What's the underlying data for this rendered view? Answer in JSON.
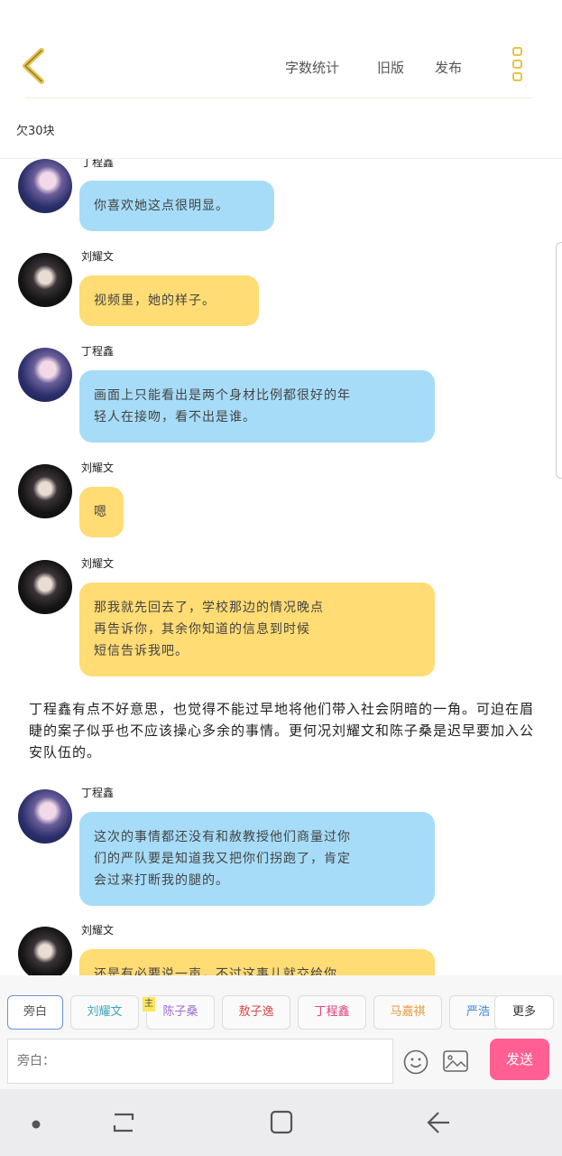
{
  "topbar": {
    "actions": [
      "字数统计",
      "旧版",
      "发布"
    ]
  },
  "coin_text": "欠30块",
  "messages": [
    {
      "type": "chat",
      "speaker": "丁程鑫",
      "side": "blue",
      "text": "你喜欢她这点很明显。"
    },
    {
      "type": "chat",
      "speaker": "刘耀文",
      "side": "yellow",
      "text": "视频里，她的样子。"
    },
    {
      "type": "chat",
      "speaker": "丁程鑫",
      "side": "blue",
      "text": "画面上只能看出是两个身材比例都很好的年\n轻人在接吻，看不出是谁。"
    },
    {
      "type": "chat",
      "speaker": "刘耀文",
      "side": "yellow",
      "text": "嗯"
    },
    {
      "type": "chat",
      "speaker": "刘耀文",
      "side": "yellow",
      "text": "那我就先回去了，学校那边的情况晚点\n再告诉你，其余你知道的信息到时候\n短信告诉我吧。"
    },
    {
      "type": "narration",
      "text": "丁程鑫有点不好意思，也觉得不能过早地将他们带入社会阴暗的一角。可迫在眉睫的案子似乎也不应该操心多余的事情。更何况刘耀文和陈子桑是迟早要加入公安队伍的。"
    },
    {
      "type": "chat",
      "speaker": "丁程鑫",
      "side": "blue",
      "text": "这次的事情都还没有和赦教授他们商量过你\n们的严队要是知道我又把你们拐跑了，肯定\n会过来打断我的腿的。"
    },
    {
      "type": "chat",
      "speaker": "刘耀文",
      "side": "yellow",
      "text": "还是有必要说一声，不过这事儿就交给你"
    }
  ],
  "characters": [
    {
      "label": "旁白",
      "color": "#555555",
      "active": true
    },
    {
      "label": "刘耀文",
      "color": "#3aa7b8"
    },
    {
      "label": "陈子桑",
      "color": "#9a6fd0"
    },
    {
      "label": "敖子逸",
      "color": "#d94a4a"
    },
    {
      "label": "丁程鑫",
      "color": "#e0407a"
    },
    {
      "label": "马嘉祺",
      "color": "#e69a3c"
    },
    {
      "label": "严浩翔",
      "color": "#3a8bd8"
    }
  ],
  "lead_badge": "主",
  "more_label": "更多",
  "input": {
    "placeholder": "旁白："
  },
  "send_label": "发送",
  "colors": {
    "send": "#ff5f92",
    "bubble_blue": "#a6dcf8",
    "bubble_yellow": "#ffdc74",
    "accent": "#e7c24a"
  }
}
